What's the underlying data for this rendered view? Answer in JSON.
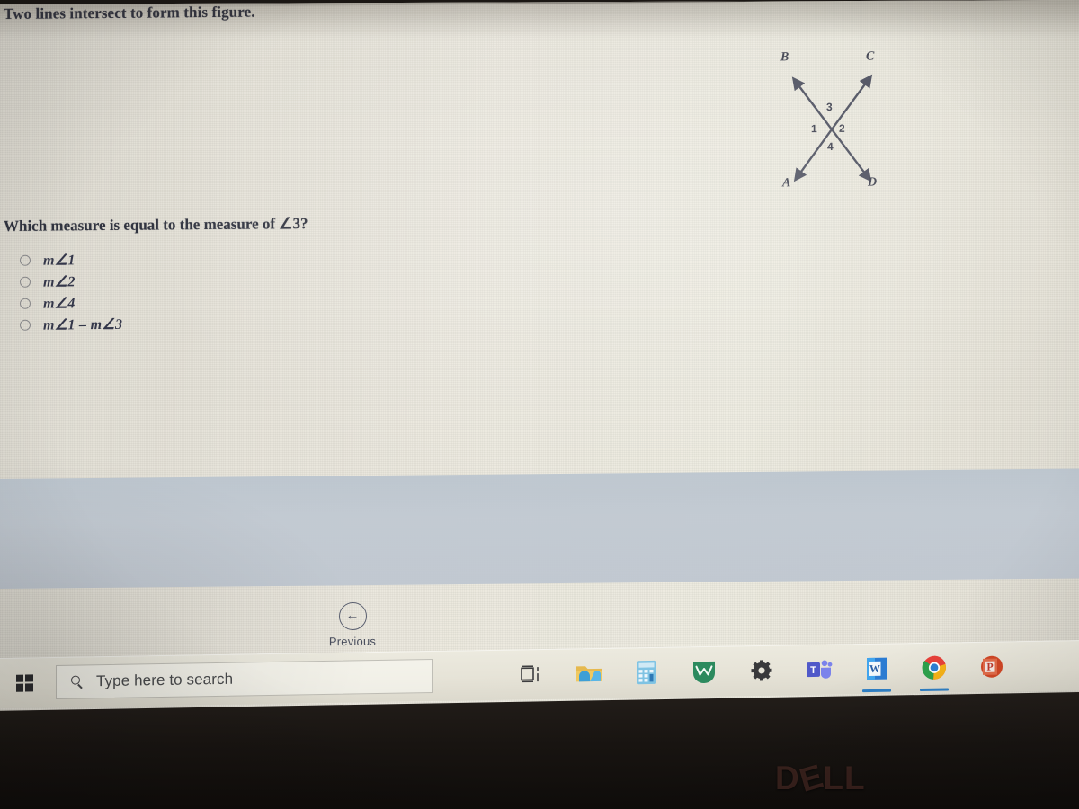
{
  "quiz": {
    "prompt": "Two lines intersect to form this figure.",
    "question": "Which measure is equal to the measure of ∠3?",
    "choices": [
      {
        "label": "m∠1",
        "selected": false
      },
      {
        "label": "m∠2",
        "selected": false
      },
      {
        "label": "m∠4",
        "selected": false
      },
      {
        "label": "m∠1 – m∠3",
        "selected": false
      }
    ],
    "figure": {
      "description": "Two lines intersecting to form an X with four labeled angles",
      "endpoint_labels": [
        "B",
        "C",
        "A",
        "D"
      ],
      "angle_labels": [
        "3",
        "1",
        "2",
        "4"
      ],
      "label_B": "B",
      "label_C": "C",
      "label_A": "A",
      "label_D": "D",
      "angle_top": "3",
      "angle_left": "1",
      "angle_right": "2",
      "angle_bottom": "4"
    },
    "navigation": {
      "previous_label": "Previous",
      "previous_icon": "arrow-left-circle-icon"
    }
  },
  "taskbar": {
    "start_icon": "windows-logo-icon",
    "search_placeholder": "Type here to search",
    "search_icon": "search-icon",
    "search_value": "",
    "items": [
      {
        "name": "task-view-icon",
        "label": "Task View",
        "active": false
      },
      {
        "name": "file-explorer-icon",
        "label": "File Explorer",
        "active": false
      },
      {
        "name": "calculator-icon",
        "label": "Calculator",
        "active": false
      },
      {
        "name": "wattpad-icon",
        "label": "Wattpad",
        "active": false
      },
      {
        "name": "settings-gear-icon",
        "label": "Settings",
        "active": false
      },
      {
        "name": "microsoft-teams-icon",
        "label": "Microsoft Teams",
        "active": false
      },
      {
        "name": "microsoft-word-icon",
        "label": "Word",
        "active": true
      },
      {
        "name": "google-chrome-icon",
        "label": "Google Chrome",
        "active": true
      },
      {
        "name": "powerpoint-icon",
        "label": "PowerPoint",
        "active": false
      }
    ]
  },
  "device": {
    "brand": "DELL"
  },
  "colors": {
    "page_bg": "#e9e6db",
    "band": "#bcc4ce",
    "text": "#30333f",
    "taskbar_bg": "#e6e3d7",
    "accent_blue": "#2f7fc4",
    "figure_stroke": "#4a4d5c"
  }
}
